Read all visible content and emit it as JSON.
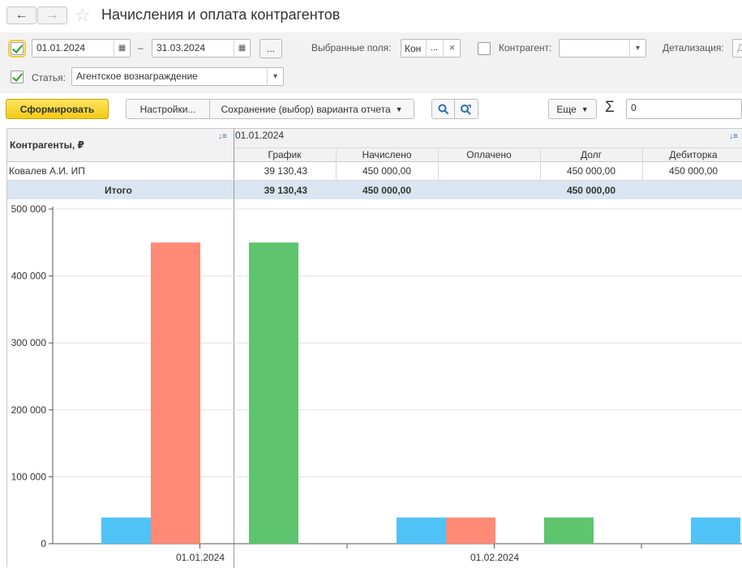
{
  "window": {
    "title": "Начисления и оплата контрагентов",
    "back_icon": "←",
    "forward_icon": "→",
    "favorite_icon": "☆"
  },
  "filters": {
    "period_enabled": true,
    "date_from": "01.01.2024",
    "date_dash": "–",
    "date_to": "31.03.2024",
    "more_label": "...",
    "selected_fields_label": "Выбранные поля:",
    "selected_fields_value": "Кон",
    "selected_fields_more": "...",
    "selected_fields_clear": "×",
    "counterparty_label": "Контрагент:",
    "counterparty_value": "",
    "detail_label": "Детализация:",
    "detail_value": "Д",
    "article_label": "Статья:",
    "article_value": "Агентское вознаграждение"
  },
  "toolbar": {
    "generate_label": "Сформировать",
    "settings_label": "Настройки...",
    "save_variant_label": "Сохранение (выбор) варианта отчета",
    "more_label": "Еще",
    "sum_icon": "Σ",
    "sum_value": "0"
  },
  "report": {
    "row_header": "Контрагенты, ₽",
    "period_header": "01.01.2024",
    "columns": [
      "График",
      "Начислено",
      "Оплачено",
      "Долг",
      "Дебиторка"
    ],
    "rows": [
      {
        "name": "Ковалев А.И. ИП",
        "values": [
          "39 130,43",
          "450 000,00",
          "",
          "450 000,00",
          "450 000,00"
        ]
      }
    ],
    "total": {
      "name": "Итого",
      "values": [
        "39 130,43",
        "450 000,00",
        "",
        "450 000,00",
        ""
      ]
    }
  },
  "colors": {
    "blue": "#4fc3f7",
    "red": "#ff8a75",
    "green": "#5ec46d"
  },
  "chart_data": {
    "type": "bar",
    "y_ticks": [
      "500 000",
      "400 000",
      "300 000",
      "200 000",
      "100 000",
      "0"
    ],
    "ylim": [
      0,
      500000
    ],
    "categories": [
      "01.01.2024",
      "",
      "01.02.2024",
      ""
    ],
    "series": [
      {
        "color": "blue",
        "values": [
          39130.43,
          0,
          39130.43,
          0
        ]
      },
      {
        "color": "red",
        "values": [
          450000,
          0,
          39130.43,
          0
        ]
      },
      {
        "color": "green",
        "values": [
          0,
          450000,
          0,
          39130.43
        ]
      },
      {
        "color": "blue",
        "values": [
          0,
          0,
          0,
          39130.43
        ]
      }
    ]
  }
}
